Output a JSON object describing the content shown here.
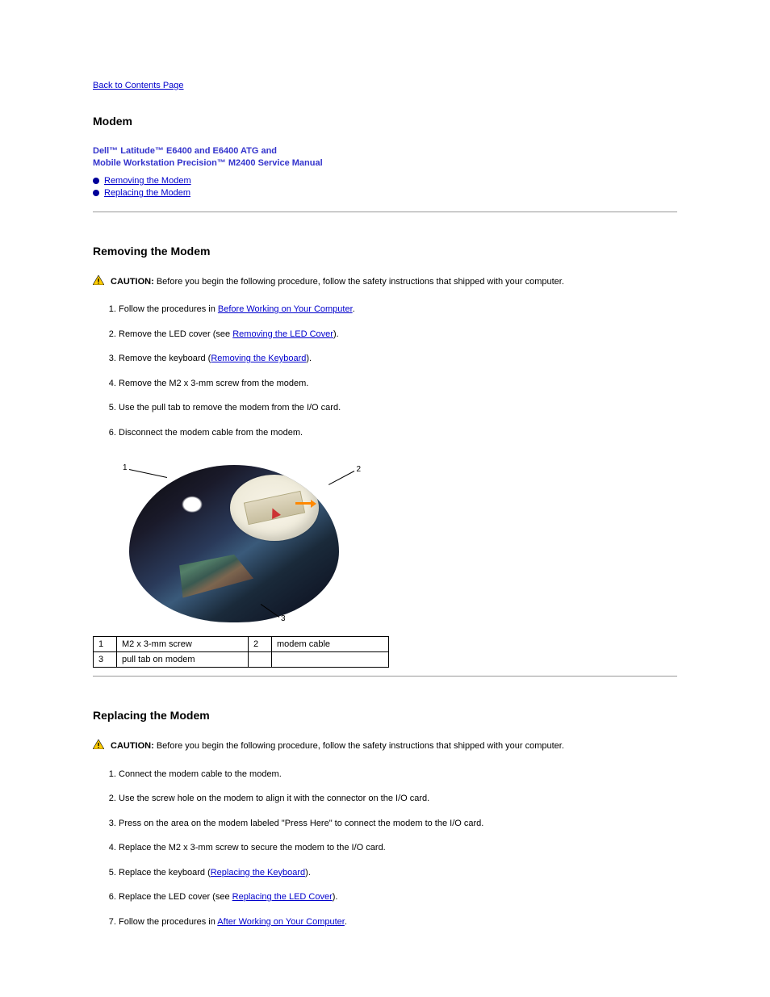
{
  "nav": {
    "back": "Back to Contents Page"
  },
  "header": {
    "main_title": "  Modem",
    "subtitle_line1": "Dell™ Latitude™ E6400 and E6400 ATG and",
    "subtitle_line2": "Mobile Workstation Precision™ M2400 Service Manual"
  },
  "toc": [
    {
      "label": "Removing the Modem"
    },
    {
      "label": "Replacing the Modem"
    }
  ],
  "removing": {
    "heading": "Removing the Modem",
    "caution_label": "CAUTION:",
    "caution_text": " Before you begin the following procedure, follow the safety instructions that shipped with your computer.",
    "steps": [
      {
        "pre": "Follow the procedures in ",
        "link": "Before Working on Your Computer",
        "post": "."
      },
      {
        "pre": "Remove the LED cover (see ",
        "link": "Removing the LED Cover",
        "post": ")."
      },
      {
        "pre": "Remove the keyboard (",
        "link": "Removing the Keyboard",
        "post": ")."
      },
      {
        "text": "Remove the M2 x 3-mm screw from the modem."
      },
      {
        "text": "Use the pull tab to remove the modem from the I/O card."
      },
      {
        "text": "Disconnect the modem cable from the modem."
      }
    ]
  },
  "figure": {
    "callouts": {
      "c1": "1",
      "c2": "2",
      "c3": "3"
    },
    "parts": [
      {
        "n": "1",
        "label": "M2 x 3-mm screw",
        "n2": "2",
        "label2": "modem cable"
      },
      {
        "n": "3",
        "label": "pull tab on modem"
      }
    ]
  },
  "replacing": {
    "heading": "Replacing the Modem",
    "caution_label": "CAUTION:",
    "caution_text": " Before you begin the following procedure, follow the safety instructions that shipped with your computer.",
    "steps": [
      {
        "text": "Connect the modem cable to the modem."
      },
      {
        "text": "Use the screw hole on the modem to align it with the connector on the I/O card."
      },
      {
        "text": "Press on the area on the modem labeled \"Press Here\" to connect the modem to the I/O card."
      },
      {
        "text": "Replace the M2 x 3-mm screw to secure the modem to the I/O card."
      },
      {
        "pre": "Replace the keyboard (",
        "link": "Replacing the Keyboard",
        "post": ")."
      },
      {
        "pre": "Replace the LED cover (see ",
        "link": "Replacing the LED Cover",
        "post": ")."
      },
      {
        "pre": "Follow the procedures in ",
        "link": "After Working on Your Computer",
        "post": "."
      }
    ]
  }
}
